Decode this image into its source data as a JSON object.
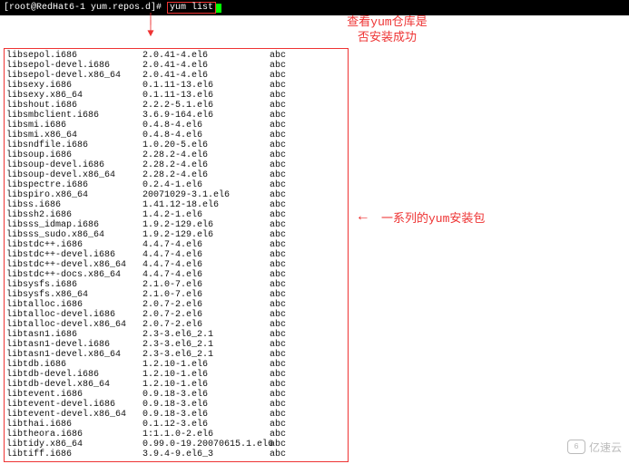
{
  "terminal": {
    "prompt": "[root@RedHat6-1 yum.repos.d]#",
    "command": "yum list"
  },
  "annotations": {
    "top_line1": "查看yum仓库是",
    "top_line2": "否安装成功",
    "side": "一系列的yum安装包"
  },
  "watermark": {
    "logo": "6",
    "text": "亿速云"
  },
  "packages": [
    {
      "name": "libsepol.i686",
      "ver": "2.0.41-4.el6",
      "repo": "abc"
    },
    {
      "name": "libsepol-devel.i686",
      "ver": "2.0.41-4.el6",
      "repo": "abc"
    },
    {
      "name": "libsepol-devel.x86_64",
      "ver": "2.0.41-4.el6",
      "repo": "abc"
    },
    {
      "name": "libsexy.i686",
      "ver": "0.1.11-13.el6",
      "repo": "abc"
    },
    {
      "name": "libsexy.x86_64",
      "ver": "0.1.11-13.el6",
      "repo": "abc"
    },
    {
      "name": "libshout.i686",
      "ver": "2.2.2-5.1.el6",
      "repo": "abc"
    },
    {
      "name": "libsmbclient.i686",
      "ver": "3.6.9-164.el6",
      "repo": "abc"
    },
    {
      "name": "libsmi.i686",
      "ver": "0.4.8-4.el6",
      "repo": "abc"
    },
    {
      "name": "libsmi.x86_64",
      "ver": "0.4.8-4.el6",
      "repo": "abc"
    },
    {
      "name": "libsndfile.i686",
      "ver": "1.0.20-5.el6",
      "repo": "abc"
    },
    {
      "name": "libsoup.i686",
      "ver": "2.28.2-4.el6",
      "repo": "abc"
    },
    {
      "name": "libsoup-devel.i686",
      "ver": "2.28.2-4.el6",
      "repo": "abc"
    },
    {
      "name": "libsoup-devel.x86_64",
      "ver": "2.28.2-4.el6",
      "repo": "abc"
    },
    {
      "name": "libspectre.i686",
      "ver": "0.2.4-1.el6",
      "repo": "abc"
    },
    {
      "name": "libspiro.x86_64",
      "ver": "20071029-3.1.el6",
      "repo": "abc"
    },
    {
      "name": "libss.i686",
      "ver": "1.41.12-18.el6",
      "repo": "abc"
    },
    {
      "name": "libssh2.i686",
      "ver": "1.4.2-1.el6",
      "repo": "abc"
    },
    {
      "name": "libsss_idmap.i686",
      "ver": "1.9.2-129.el6",
      "repo": "abc"
    },
    {
      "name": "libsss_sudo.x86_64",
      "ver": "1.9.2-129.el6",
      "repo": "abc"
    },
    {
      "name": "libstdc++.i686",
      "ver": "4.4.7-4.el6",
      "repo": "abc"
    },
    {
      "name": "libstdc++-devel.i686",
      "ver": "4.4.7-4.el6",
      "repo": "abc"
    },
    {
      "name": "libstdc++-devel.x86_64",
      "ver": "4.4.7-4.el6",
      "repo": "abc"
    },
    {
      "name": "libstdc++-docs.x86_64",
      "ver": "4.4.7-4.el6",
      "repo": "abc"
    },
    {
      "name": "libsysfs.i686",
      "ver": "2.1.0-7.el6",
      "repo": "abc"
    },
    {
      "name": "libsysfs.x86_64",
      "ver": "2.1.0-7.el6",
      "repo": "abc"
    },
    {
      "name": "libtalloc.i686",
      "ver": "2.0.7-2.el6",
      "repo": "abc"
    },
    {
      "name": "libtalloc-devel.i686",
      "ver": "2.0.7-2.el6",
      "repo": "abc"
    },
    {
      "name": "libtalloc-devel.x86_64",
      "ver": "2.0.7-2.el6",
      "repo": "abc"
    },
    {
      "name": "libtasn1.i686",
      "ver": "2.3-3.el6_2.1",
      "repo": "abc"
    },
    {
      "name": "libtasn1-devel.i686",
      "ver": "2.3-3.el6_2.1",
      "repo": "abc"
    },
    {
      "name": "libtasn1-devel.x86_64",
      "ver": "2.3-3.el6_2.1",
      "repo": "abc"
    },
    {
      "name": "libtdb.i686",
      "ver": "1.2.10-1.el6",
      "repo": "abc"
    },
    {
      "name": "libtdb-devel.i686",
      "ver": "1.2.10-1.el6",
      "repo": "abc"
    },
    {
      "name": "libtdb-devel.x86_64",
      "ver": "1.2.10-1.el6",
      "repo": "abc"
    },
    {
      "name": "libtevent.i686",
      "ver": "0.9.18-3.el6",
      "repo": "abc"
    },
    {
      "name": "libtevent-devel.i686",
      "ver": "0.9.18-3.el6",
      "repo": "abc"
    },
    {
      "name": "libtevent-devel.x86_64",
      "ver": "0.9.18-3.el6",
      "repo": "abc"
    },
    {
      "name": "libthai.i686",
      "ver": "0.1.12-3.el6",
      "repo": "abc"
    },
    {
      "name": "libtheora.i686",
      "ver": "1:1.1.0-2.el6",
      "repo": "abc"
    },
    {
      "name": "libtidy.x86_64",
      "ver": "0.99.0-19.20070615.1.el6",
      "repo": "abc"
    },
    {
      "name": "libtiff.i686",
      "ver": "3.9.4-9.el6_3",
      "repo": "abc"
    }
  ]
}
